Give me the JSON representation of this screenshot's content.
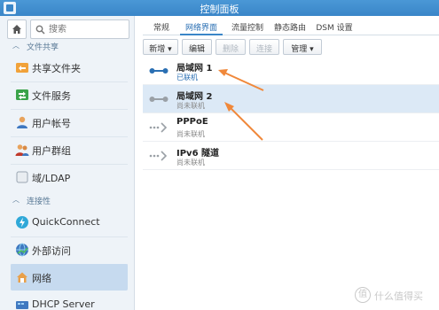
{
  "window": {
    "title": "控制面板"
  },
  "sidebar": {
    "search_placeholder": "搜索",
    "sections": [
      {
        "label": "文件共享"
      },
      {
        "label": "连接性"
      }
    ],
    "items": [
      {
        "label": "共享文件夹",
        "icon": "shared-folder-icon"
      },
      {
        "label": "文件服务",
        "icon": "file-services-icon"
      },
      {
        "label": "用户帐号",
        "icon": "user-icon"
      },
      {
        "label": "用户群组",
        "icon": "group-icon"
      },
      {
        "label": "域/LDAP",
        "icon": "domain-icon"
      },
      {
        "label": "QuickConnect",
        "icon": "quickconnect-icon"
      },
      {
        "label": "外部访问",
        "icon": "external-access-icon"
      },
      {
        "label": "网络",
        "icon": "network-icon",
        "active": true
      },
      {
        "label": "DHCP Server",
        "icon": "dhcp-icon"
      }
    ]
  },
  "tabs": [
    {
      "label": "常规"
    },
    {
      "label": "网络界面",
      "active": true
    },
    {
      "label": "流量控制"
    },
    {
      "label": "静态路由"
    },
    {
      "label": "DSM 设置"
    }
  ],
  "toolbar": {
    "create_label": "新增",
    "edit_label": "编辑",
    "delete_label": "删除",
    "connect_label": "连接",
    "manage_label": "管理"
  },
  "interfaces": [
    {
      "name": "局域网 1",
      "status": "已联机",
      "state": "connected"
    },
    {
      "name": "局域网 2",
      "status": "尚未联机",
      "state": "disconnected",
      "selected": true
    },
    {
      "name": "PPPoE",
      "status": "尚未联机",
      "state": "disconnected"
    },
    {
      "name": "IPv6 隧道",
      "status": "尚未联机",
      "state": "disconnected"
    }
  ],
  "colors": {
    "accent": "#3a86c8",
    "connected": "#2a6fb3",
    "disconnected": "#888888",
    "annotation_arrow": "#f0883a"
  },
  "watermark": {
    "logo": "值",
    "text": "什么值得买"
  }
}
